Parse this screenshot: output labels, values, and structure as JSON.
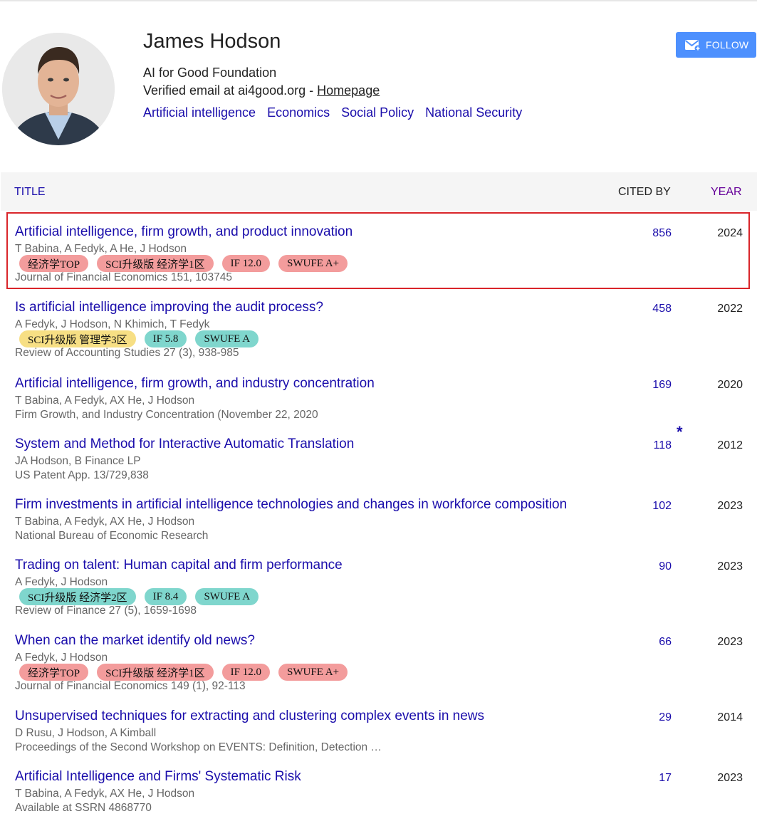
{
  "profile": {
    "name": "James Hodson",
    "affiliation": "AI for Good Foundation",
    "email_text": "Verified email at ai4good.org - ",
    "homepage_label": "Homepage",
    "interests": [
      "Artificial intelligence",
      "Economics",
      "Social Policy",
      "National Security"
    ],
    "follow_label": "FOLLOW"
  },
  "table": {
    "col_title": "TITLE",
    "col_cited": "CITED BY",
    "col_year": "YEAR"
  },
  "colors": {
    "link": "#1a0dab",
    "follow_button": "#4d90fe",
    "highlight_border": "#d9252a",
    "tag_red": "#f39c9c",
    "tag_yellow": "#f7df84",
    "tag_teal": "#7fd6cd"
  },
  "articles": [
    {
      "title": "Artificial intelligence, firm growth, and product innovation",
      "authors": "T Babina, A Fedyk, A He, J Hodson",
      "venue": "Journal of Financial Economics 151, 103745",
      "cited": "856",
      "year": "2024",
      "highlighted": true,
      "tags": [
        {
          "text": "经济学TOP",
          "color": "red"
        },
        {
          "text": "SCI升级版 经济学1区",
          "color": "red"
        },
        {
          "text": "IF 12.0",
          "color": "red"
        },
        {
          "text": "SWUFE A+",
          "color": "red"
        }
      ]
    },
    {
      "title": "Is artificial intelligence improving the audit process?",
      "authors": "A Fedyk, J Hodson, N Khimich, T Fedyk",
      "venue": "Review of Accounting Studies 27 (3), 938-985",
      "cited": "458",
      "year": "2022",
      "tags": [
        {
          "text": "SCI升级版 管理学3区",
          "color": "yellow"
        },
        {
          "text": "IF 5.8",
          "color": "teal"
        },
        {
          "text": "SWUFE A",
          "color": "teal"
        }
      ]
    },
    {
      "title": "Artificial intelligence, firm growth, and industry concentration",
      "authors": "T Babina, A Fedyk, AX He, J Hodson",
      "venue": "Firm Growth, and Industry Concentration (November 22, 2020",
      "cited": "169",
      "year": "2020",
      "tags": []
    },
    {
      "title": "System and Method for Interactive Automatic Translation",
      "authors": "JA Hodson, B Finance LP",
      "venue": "US Patent App. 13/729,838",
      "cited": "118",
      "year": "2012",
      "star": "*",
      "tags": []
    },
    {
      "title": "Firm investments in artificial intelligence technologies and changes in workforce composition",
      "authors": "T Babina, A Fedyk, AX He, J Hodson",
      "venue": "National Bureau of Economic Research",
      "cited": "102",
      "year": "2023",
      "tags": []
    },
    {
      "title": "Trading on talent: Human capital and firm performance",
      "authors": "A Fedyk, J Hodson",
      "venue": "Review of Finance 27 (5), 1659-1698",
      "cited": "90",
      "year": "2023",
      "tags": [
        {
          "text": "SCI升级版 经济学2区",
          "color": "teal"
        },
        {
          "text": "IF 8.4",
          "color": "teal"
        },
        {
          "text": "SWUFE A",
          "color": "teal"
        }
      ]
    },
    {
      "title": "When can the market identify old news?",
      "authors": "A Fedyk, J Hodson",
      "venue": "Journal of Financial Economics 149 (1), 92-113",
      "cited": "66",
      "year": "2023",
      "tags": [
        {
          "text": "经济学TOP",
          "color": "red"
        },
        {
          "text": "SCI升级版 经济学1区",
          "color": "red"
        },
        {
          "text": "IF 12.0",
          "color": "red"
        },
        {
          "text": "SWUFE A+",
          "color": "red"
        }
      ]
    },
    {
      "title": "Unsupervised techniques for extracting and clustering complex events in news",
      "authors": "D Rusu, J Hodson, A Kimball",
      "venue": "Proceedings of the Second Workshop on EVENTS: Definition, Detection …",
      "cited": "29",
      "year": "2014",
      "tags": []
    },
    {
      "title": "Artificial Intelligence and Firms' Systematic Risk",
      "authors": "T Babina, A Fedyk, AX He, J Hodson",
      "venue": "Available at SSRN 4868770",
      "cited": "17",
      "year": "2023",
      "tags": []
    }
  ]
}
